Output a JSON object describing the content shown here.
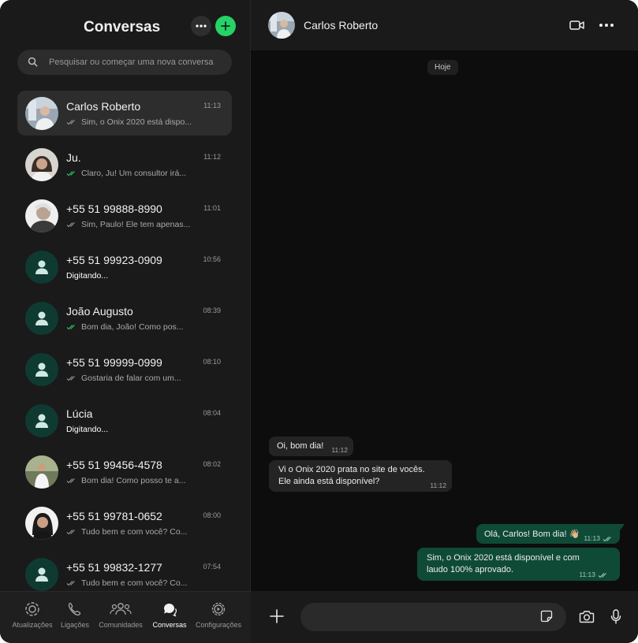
{
  "sidebar": {
    "title": "Conversas",
    "search_placeholder": "Pesquisar ou começar uma nova conversa",
    "chats": [
      {
        "name": "Carlos Roberto",
        "time": "11:13",
        "preview": "Sim, o Onix 2020 está dispo...",
        "status": "read",
        "avatar": "photo"
      },
      {
        "name": "Ju.",
        "time": "11:12",
        "preview": "Claro, Ju! Um consultor irá...",
        "status": "delivered-green",
        "avatar": "photo"
      },
      {
        "name": "+55 51 99888-8990",
        "time": "11:01",
        "preview": "Sim, Paulo! Ele tem apenas...",
        "status": "read",
        "avatar": "photo"
      },
      {
        "name": "+55 51 99923-0909",
        "time": "10:56",
        "preview": "Digitando...",
        "status": "typing",
        "avatar": "default"
      },
      {
        "name": "João Augusto",
        "time": "08:39",
        "preview": "Bom dia, João! Como pos...",
        "status": "delivered-green",
        "avatar": "default"
      },
      {
        "name": "+55 51 99999-0999",
        "time": "08:10",
        "preview": "Gostaria de falar com um...",
        "status": "read",
        "avatar": "default"
      },
      {
        "name": "Lúcia",
        "time": "08:04",
        "preview": "Digitando...",
        "status": "typing",
        "avatar": "default"
      },
      {
        "name": "+55 51 99456-4578",
        "time": "08:02",
        "preview": "Bom dia! Como posso te a...",
        "status": "read",
        "avatar": "photo"
      },
      {
        "name": "+55 51 99781-0652",
        "time": "08:00",
        "preview": "Tudo bem e com você? Co...",
        "status": "read",
        "avatar": "photo"
      },
      {
        "name": "+55 51 99832-1277",
        "time": "07:54",
        "preview": "Tudo bem e com você? Co...",
        "status": "read",
        "avatar": "default"
      }
    ]
  },
  "nav": [
    {
      "label": "Atualizações",
      "icon": "updates-icon",
      "active": false
    },
    {
      "label": "Ligações",
      "icon": "phone-icon",
      "active": false
    },
    {
      "label": "Comunidades",
      "icon": "communities-icon",
      "active": false
    },
    {
      "label": "Conversas",
      "icon": "chats-icon",
      "active": true
    },
    {
      "label": "Configurações",
      "icon": "settings-icon",
      "active": false
    }
  ],
  "conversation": {
    "contact_name": "Carlos Roberto",
    "date_label": "Hoje",
    "messages": [
      {
        "direction": "in",
        "lines": [
          "Oi, bom dia!"
        ],
        "time": "11:12"
      },
      {
        "direction": "in",
        "lines": [
          "Vi o Onix 2020 prata no site de vocês.",
          "Ele ainda está disponível?"
        ],
        "time": "11:12"
      },
      {
        "direction": "out",
        "lines": [
          "Olá, Carlos! Bom dia! 👋🏼"
        ],
        "time": "11:13"
      },
      {
        "direction": "out",
        "lines": [
          "Sim, o Onix 2020 está disponível e com",
          "laudo 100% aprovado."
        ],
        "time": "11:13"
      }
    ]
  },
  "composer": {
    "placeholder": ""
  },
  "colors": {
    "accent": "#25d366",
    "outgoing_bubble": "#0f4a37",
    "incoming_bubble": "#242424",
    "avatar_default": "#0f3a32"
  }
}
